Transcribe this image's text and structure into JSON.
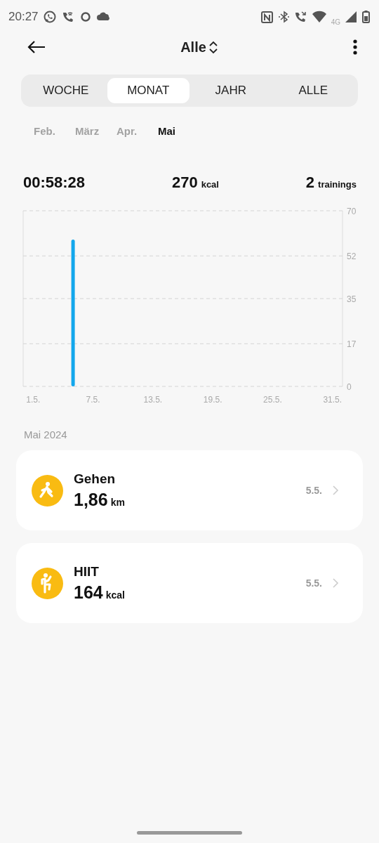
{
  "status_bar": {
    "time": "20:27",
    "network": "4G"
  },
  "header": {
    "title": "Alle"
  },
  "tabs": [
    {
      "label": "WOCHE",
      "selected": false
    },
    {
      "label": "MONAT",
      "selected": true
    },
    {
      "label": "JAHR",
      "selected": false
    },
    {
      "label": "ALLE",
      "selected": false
    }
  ],
  "months": [
    {
      "label": "Feb.",
      "selected": false
    },
    {
      "label": "März",
      "selected": false
    },
    {
      "label": "Apr.",
      "selected": false
    },
    {
      "label": "Mai",
      "selected": true
    }
  ],
  "summary": [
    {
      "value": "00:58:28"
    },
    {
      "value": "270",
      "unit": "kcal"
    },
    {
      "value": "2",
      "unit": "trainings"
    }
  ],
  "chart": {
    "chart_data": {
      "type": "bar",
      "categories": [
        "1.5.",
        null,
        null,
        null,
        null,
        null,
        "7.5.",
        null,
        null,
        null,
        null,
        null,
        "13.5.",
        null,
        null,
        null,
        null,
        null,
        "19.5.",
        null,
        null,
        null,
        null,
        null,
        "25.5.",
        null,
        null,
        null,
        null,
        null,
        "31.5."
      ],
      "values": [
        null,
        null,
        null,
        null,
        58.5,
        null,
        null,
        null,
        null,
        null,
        null,
        null,
        null,
        null,
        null,
        null,
        null,
        null,
        null,
        null,
        null,
        null,
        null,
        null,
        null,
        null,
        null,
        null,
        null,
        null,
        null
      ],
      "ylim": [
        0,
        70
      ],
      "grid": true,
      "yticks": [
        0,
        17,
        35,
        52,
        70
      ]
    }
  },
  "section_title": "Mai 2024",
  "workouts": [
    {
      "kind": "walk",
      "name": "Gehen",
      "value": "1,86",
      "unit": "km",
      "date": "5.5."
    },
    {
      "kind": "hiit",
      "name": "HIIT",
      "value": "164",
      "unit": "kcal",
      "date": "5.5."
    }
  ]
}
